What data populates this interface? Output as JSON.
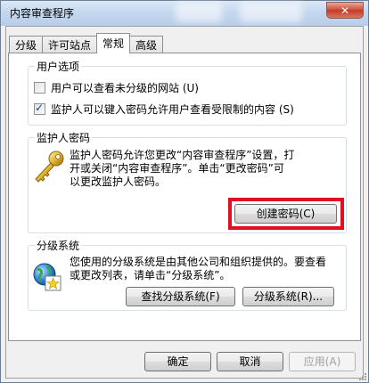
{
  "window": {
    "title": "内容审查程序",
    "close_label": "✕"
  },
  "tabs": [
    {
      "label": "分级",
      "active": false
    },
    {
      "label": "许可站点",
      "active": false
    },
    {
      "label": "常规",
      "active": true
    },
    {
      "label": "高级",
      "active": false
    }
  ],
  "user_options": {
    "legend": "用户选项",
    "opt1": {
      "label": "用户可以查看未分级的网站 (U)",
      "checked": false
    },
    "opt2": {
      "label": "监护人可以键入密码允许用户查看受限制的内容 (S)",
      "checked": true
    }
  },
  "supervisor": {
    "legend": "监护人密码",
    "line1": "监护人密码允许您更改“内容审查程序”设置，打",
    "line2": "开或关闭“内容审查程序”。单击“更改密码”可",
    "line3": "以更改监护人密码。",
    "create_button": "创建密码(C)",
    "icon": "key-icon",
    "highlight_color": "#e0101c"
  },
  "rating_systems": {
    "legend": "分级系统",
    "line1": "您使用的分级系统是由其他公司和组织提供的。要查看",
    "line2": "或更改列表，请单击“分级系统”。",
    "find_button": "查找分级系统(F)",
    "systems_button": "分级系统(R)...",
    "icon": "globe-certificate-icon"
  },
  "footer": {
    "ok": "确定",
    "cancel": "取消",
    "apply": "应用(A)"
  }
}
